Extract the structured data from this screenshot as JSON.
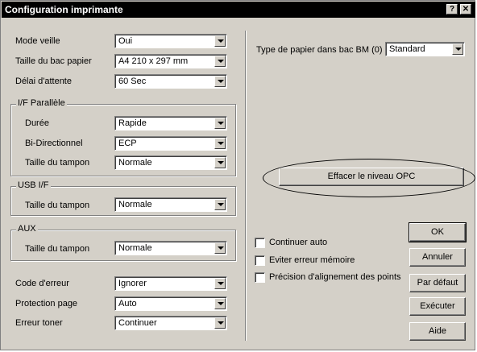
{
  "window": {
    "title": "Configuration imprimante",
    "help_label": "?",
    "close_label": "✕"
  },
  "left": {
    "rows_top": [
      {
        "label": "Mode veille",
        "value": "Oui"
      },
      {
        "label": "Taille du bac papier",
        "value": "A4 210 x 297 mm"
      },
      {
        "label": "Délai d'attente",
        "value": "60 Sec"
      }
    ],
    "parallel": {
      "title": "I/F Parallèle",
      "rows": [
        {
          "label": "Durée",
          "value": "Rapide"
        },
        {
          "label": "Bi-Directionnel",
          "value": "ECP"
        },
        {
          "label": "Taille du tampon",
          "value": "Normale"
        }
      ]
    },
    "usb": {
      "title": "USB I/F",
      "label": "Taille du tampon",
      "value": "Normale"
    },
    "aux": {
      "title": "AUX",
      "label": "Taille du tampon",
      "value": "Normale"
    },
    "rows_bottom": [
      {
        "label": "Code d'erreur",
        "value": "Ignorer"
      },
      {
        "label": "Protection page",
        "value": "Auto"
      },
      {
        "label": "Erreur toner",
        "value": "Continuer"
      }
    ]
  },
  "right": {
    "paper_type_label": "Type de papier dans bac BM (0)",
    "paper_type_value": "Standard",
    "clear_opc_label": "Effacer le niveau OPC",
    "checkboxes": [
      {
        "label": "Continuer auto",
        "checked": false
      },
      {
        "label": "Eviter erreur mémoire",
        "checked": false
      },
      {
        "label": "Précision d'alignement des points",
        "checked": false
      }
    ],
    "buttons": {
      "ok": "OK",
      "cancel": "Annuler",
      "default": "Par défaut",
      "execute": "Exécuter",
      "help": "Aide"
    }
  }
}
